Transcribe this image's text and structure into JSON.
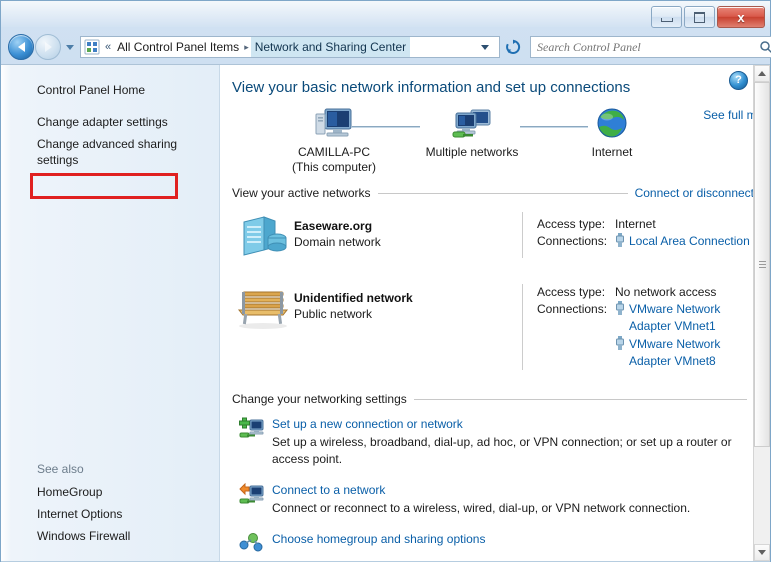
{
  "window": {
    "caption": {
      "minimize_label": "",
      "maximize_label": "",
      "close_label": "x"
    }
  },
  "navigation": {
    "back_tooltip": "Back",
    "forward_tooltip": "Forward",
    "recent_pages_tooltip": "Recent pages",
    "refresh_tooltip": "Refresh"
  },
  "breadcrumb": {
    "overflow": "«",
    "items": [
      {
        "label": "All Control Panel Items",
        "current": false
      },
      {
        "label": "Network and Sharing Center",
        "current": true
      }
    ],
    "separator": "▸"
  },
  "search": {
    "placeholder": "Search Control Panel",
    "value": ""
  },
  "sidebar": {
    "items": [
      {
        "label": "Control Panel Home",
        "highlighted": false
      },
      {
        "label": "Change adapter settings",
        "highlighted": true
      },
      {
        "label": "Change advanced sharing settings",
        "highlighted": false
      }
    ],
    "see_also": {
      "title": "See also",
      "items": [
        {
          "label": "HomeGroup"
        },
        {
          "label": "Internet Options"
        },
        {
          "label": "Windows Firewall"
        }
      ]
    }
  },
  "main": {
    "help_label": "?",
    "title": "View your basic network information and set up connections",
    "network_map": {
      "see_full_map": "See full map",
      "nodes": [
        {
          "icon": "computer-icon",
          "label": "CAMILLA-PC",
          "sublabel": "(This computer)"
        },
        {
          "icon": "multiple-networks-icon",
          "label": "Multiple networks",
          "sublabel": ""
        },
        {
          "icon": "globe-icon",
          "label": "Internet",
          "sublabel": ""
        }
      ]
    },
    "active_networks": {
      "heading": "View your active networks",
      "action": "Connect or disconnect",
      "networks": [
        {
          "icon": "domain-network-icon",
          "name": "Easeware.org",
          "type": "Domain network",
          "access_type_label": "Access type:",
          "access_type_value": "Internet",
          "connections_label": "Connections:",
          "connections": [
            {
              "icon": "network-connection-icon",
              "label": "Local Area Connection"
            }
          ]
        },
        {
          "icon": "public-network-bench-icon",
          "name": "Unidentified network",
          "type": "Public network",
          "access_type_label": "Access type:",
          "access_type_value": "No network access",
          "connections_label": "Connections:",
          "connections": [
            {
              "icon": "network-connection-icon",
              "label": "VMware Network Adapter VMnet1"
            },
            {
              "icon": "network-connection-icon",
              "label": "VMware Network Adapter VMnet8"
            }
          ]
        }
      ]
    },
    "change_settings": {
      "heading": "Change your networking settings",
      "items": [
        {
          "icon": "new-connection-icon",
          "link": "Set up a new connection or network",
          "description": "Set up a wireless, broadband, dial-up, ad hoc, or VPN connection; or set up a router or access point."
        },
        {
          "icon": "connect-network-icon",
          "link": "Connect to a network",
          "description": "Connect or reconnect to a wireless, wired, dial-up, or VPN network connection."
        },
        {
          "icon": "homegroup-icon",
          "link": "Choose homegroup and sharing options",
          "description": ""
        }
      ]
    }
  },
  "colors": {
    "link": "#0a5fa8",
    "title": "#0a4a7a",
    "highlight_box": "#e02020",
    "breadcrumb_current_bg": "#cfe6f2"
  }
}
